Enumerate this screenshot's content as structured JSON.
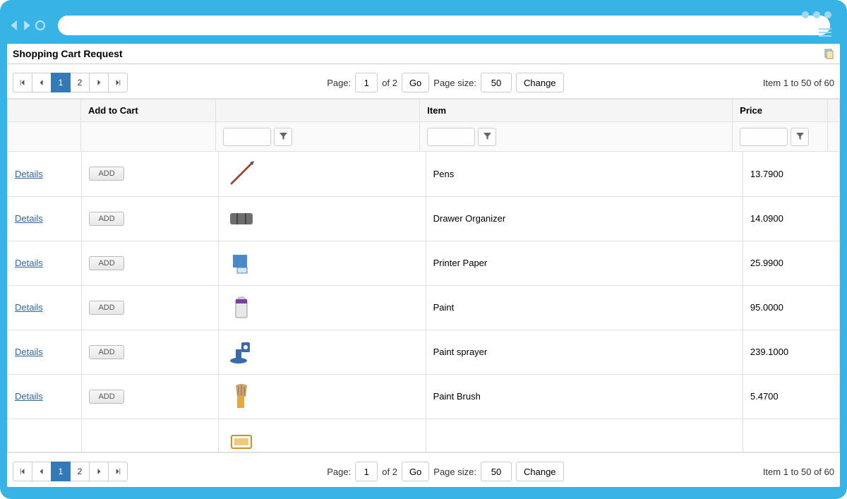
{
  "header": {
    "title": "Shopping Cart Request"
  },
  "pager": {
    "page_label": "Page:",
    "page_value": "1",
    "of_text": "of 2",
    "go_btn": "Go",
    "page_size_label": "Page size:",
    "page_size_value": "50",
    "change_btn": "Change",
    "status": "Item 1 to 50 of 60",
    "pages": [
      "1",
      "2"
    ]
  },
  "columns": {
    "details": "",
    "add_to_cart": "Add to Cart",
    "thumb": "",
    "item": "Item",
    "price": "Price"
  },
  "row_labels": {
    "details_link": "Details",
    "add_btn": "ADD"
  },
  "rows": [
    {
      "item": "Pens",
      "price": "13.7900"
    },
    {
      "item": "Drawer Organizer",
      "price": "14.0900"
    },
    {
      "item": "Printer Paper",
      "price": "25.9900"
    },
    {
      "item": "Paint",
      "price": "95.0000"
    },
    {
      "item": "Paint sprayer",
      "price": "239.1000"
    },
    {
      "item": "Paint Brush",
      "price": "5.4700"
    }
  ]
}
